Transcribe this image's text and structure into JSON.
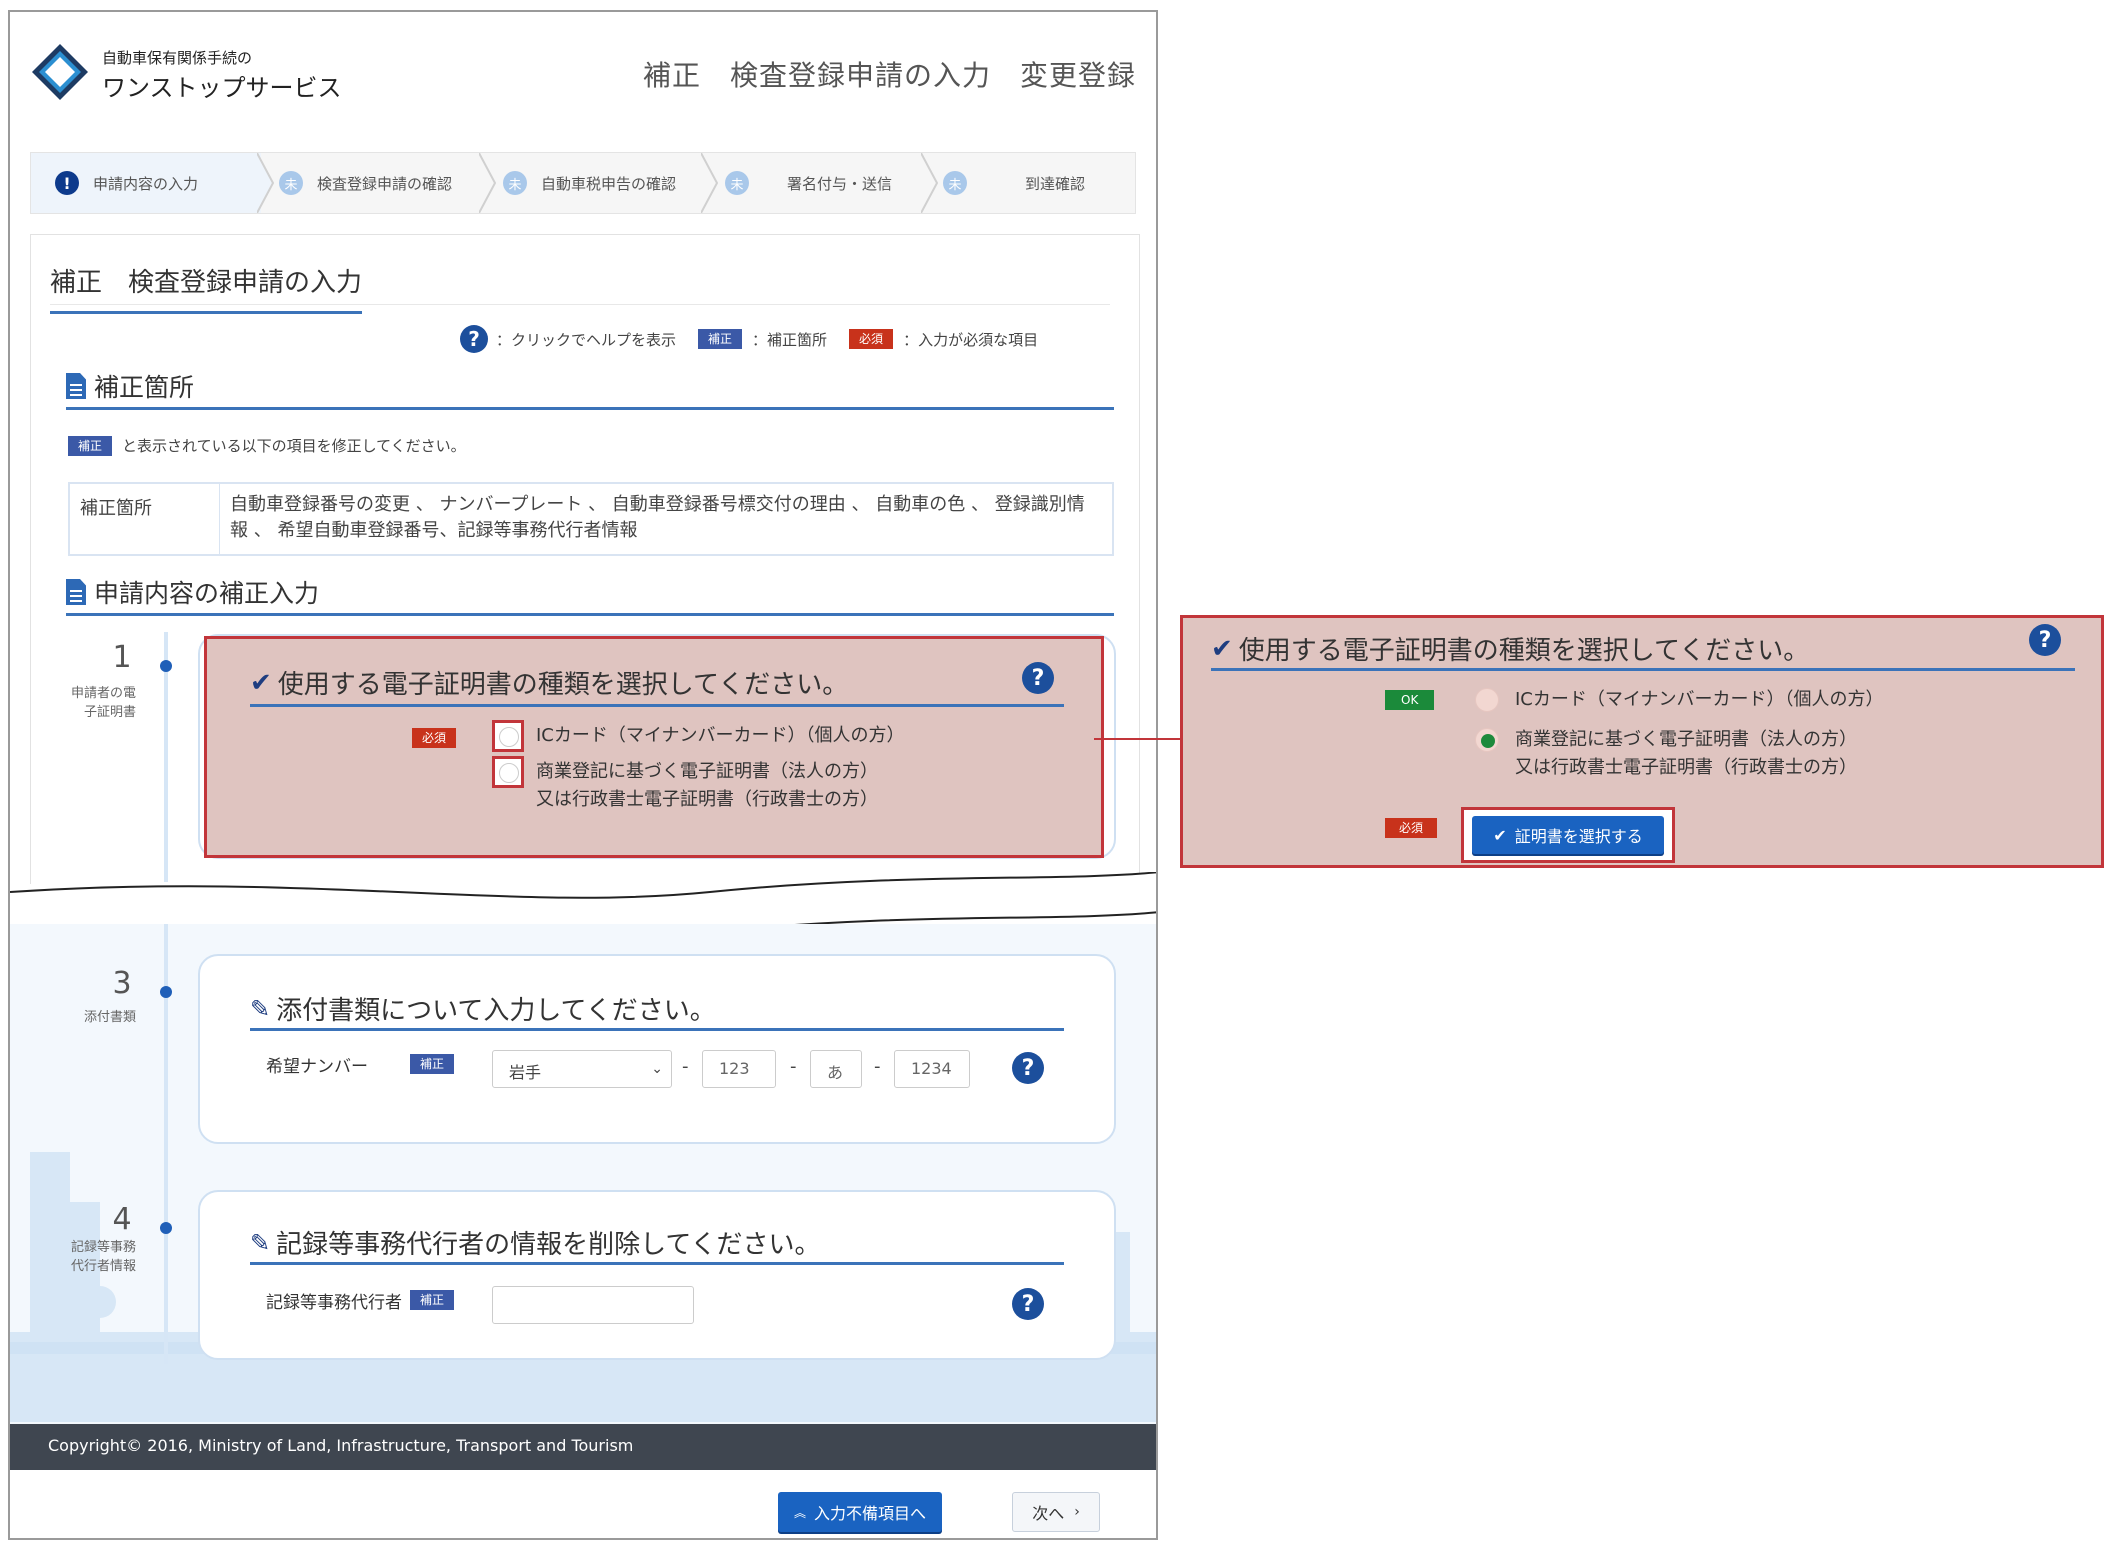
{
  "header": {
    "logo_sub": "自動車保有関係手続の",
    "logo_main": "ワンストップサービス",
    "title": "補正　検査登録申請の入力　変更登録"
  },
  "steps": [
    {
      "label": "申請内容の入力",
      "icon": "!",
      "status": "active"
    },
    {
      "label": "検査登録申請の確認",
      "icon": "未",
      "status": "pending"
    },
    {
      "label": "自動車税申告の確認",
      "icon": "未",
      "status": "pending"
    },
    {
      "label": "署名付与・送信",
      "icon": "未",
      "status": "pending"
    },
    {
      "label": "到達確認",
      "icon": "未",
      "status": "pending"
    }
  ],
  "page_title": "補正　検査登録申請の入力",
  "legend": {
    "help_icon": "?",
    "help_text": "：クリックでヘルプを表示",
    "hosei_badge": "補正",
    "hosei_text": "：補正箇所",
    "hissu_badge": "必須",
    "hissu_text": "：入力が必須な項目"
  },
  "hosei_section": {
    "title": "補正箇所",
    "note_badge": "補正",
    "note_text": "と表示されている以下の項目を修正してください。",
    "table_header": "補正箇所",
    "table_value": "自動車登録番号の変更 、 ナンバープレート 、 自動車登録番号標交付の理由 、 自動車の色 、 登録識別情報 、 希望自動車登録番号、記録等事務代行者情報"
  },
  "input_section": {
    "title": "申請内容の補正入力"
  },
  "step1": {
    "num": "1",
    "label": "申請者の電子証明書",
    "title": "使用する電子証明書の種類を選択してください。",
    "badge": "必須",
    "options": [
      {
        "text": "ICカード（マイナンバーカード）（個人の方）"
      },
      {
        "text": "商業登記に基づく電子証明書（法人の方）",
        "text2": "又は行政書士電子証明書（行政書士の方）"
      }
    ]
  },
  "step3": {
    "num": "3",
    "label": "添付書類",
    "title": "添付書類について入力してください。",
    "field_label": "希望ナンバー",
    "badge": "補正",
    "select_value": "岩手",
    "num1": "123",
    "kana": "あ",
    "num2": "1234",
    "dash": "-"
  },
  "step4": {
    "num": "4",
    "label": "記録等事務代行者情報",
    "title": "記録等事務代行者の情報を削除してください。",
    "field_label": "記録等事務代行者",
    "badge": "補正",
    "input_value": ""
  },
  "footer": {
    "copyright": "Copyright© 2016, Ministry of Land, Infrastructure, Transport and Tourism"
  },
  "buttons": {
    "prev_incomplete": "入力不備項目へ",
    "next": "次へ"
  },
  "zoom": {
    "title": "使用する電子証明書の種類を選択してください。",
    "ok_badge": "OK",
    "hissu_badge": "必須",
    "options": [
      {
        "text": "ICカード（マイナンバーカード）（個人の方）",
        "selected": false
      },
      {
        "text": "商業登記に基づく電子証明書（法人の方）",
        "text2": "又は行政書士電子証明書（行政書士の方）",
        "selected": true
      }
    ],
    "cert_button": "証明書を選択する"
  },
  "colors": {
    "accent": "#3b73b9",
    "hosei": "#3b59a7",
    "hissu": "#c8321b",
    "ok": "#1b8a3a",
    "highlight_border": "#c2353a",
    "highlight_fill": "#dfc4c0",
    "footer": "#3f4650",
    "primary_button": "#1a63c1"
  }
}
